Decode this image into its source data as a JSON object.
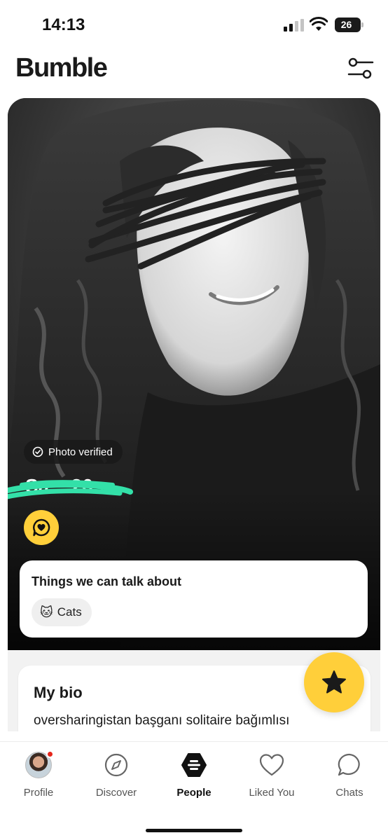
{
  "status_bar": {
    "time": "14:13",
    "battery": "26"
  },
  "header": {
    "logo": "Bumble",
    "filter_icon": "filter-sliders-icon"
  },
  "profile": {
    "verified_label": "Photo verified",
    "name_age": "Sa... 26",
    "talk_section_title": "Things we can talk about",
    "topics": [
      {
        "emoji": "🐱",
        "label": "Cats"
      }
    ],
    "bio_title": "My bio",
    "bio_text": "oversharingistan başganı solitaire bağımlısı"
  },
  "nav": {
    "items": [
      {
        "label": "Profile",
        "icon": "avatar"
      },
      {
        "label": "Discover",
        "icon": "compass-icon"
      },
      {
        "label": "People",
        "icon": "bumble-hex-icon",
        "active": true
      },
      {
        "label": "Liked You",
        "icon": "heart-icon"
      },
      {
        "label": "Chats",
        "icon": "chat-bubble-icon"
      }
    ]
  },
  "colors": {
    "accent": "#ffcf3a",
    "notification": "#e5261b"
  }
}
